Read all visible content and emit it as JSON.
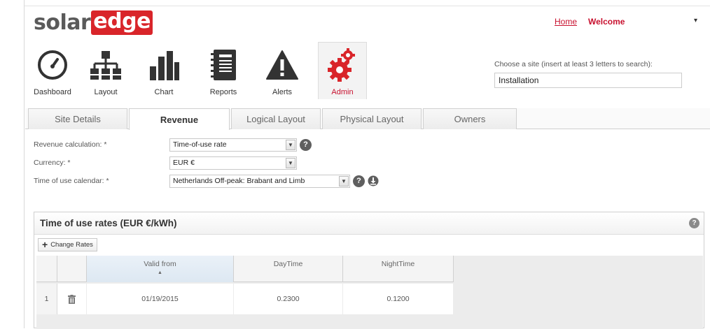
{
  "brand": {
    "part1": "solar",
    "part2": "edge"
  },
  "header": {
    "home_link": "Home",
    "welcome": "Welcome",
    "user_caret": "▾"
  },
  "nav": {
    "dashboard": "Dashboard",
    "layout": "Layout",
    "chart": "Chart",
    "reports": "Reports",
    "alerts": "Alerts",
    "admin": "Admin"
  },
  "site_chooser": {
    "label": "Choose a site (insert at least 3 letters to search):",
    "value": "Installation"
  },
  "tabs": [
    "Site Details",
    "Revenue",
    "Logical Layout",
    "Physical Layout",
    "Owners"
  ],
  "active_tab": "Revenue",
  "form": {
    "revenue_calc_label": "Revenue calculation:",
    "revenue_calc_value": "Time-of-use rate",
    "currency_label": "Currency:",
    "currency_value": "EUR €",
    "tou_calendar_label": "Time of use calendar:",
    "tou_calendar_value": "Netherlands Off-peak: Brabant and Limb",
    "required_mark": " *"
  },
  "rates_panel": {
    "title": "Time of use rates (EUR €/kWh)",
    "change_rates_button": "Change Rates",
    "help": "?",
    "columns": [
      "Valid from",
      "DayTime",
      "NightTime"
    ],
    "rows": [
      {
        "index": "1",
        "valid_from": "01/19/2015",
        "daytime": "0.2300",
        "nighttime": "0.1200"
      }
    ]
  },
  "colors": {
    "brand_red": "#d9252a",
    "link_red": "#c8102e"
  }
}
